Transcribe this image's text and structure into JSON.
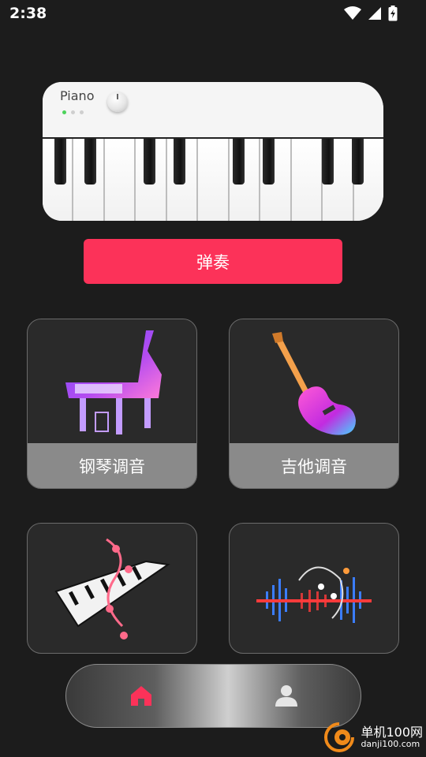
{
  "status_bar": {
    "time": "2:38"
  },
  "piano_widget": {
    "label": "Piano"
  },
  "play_button": {
    "label": "弹奏"
  },
  "tiles": {
    "piano_tuning": {
      "label": "钢琴调音"
    },
    "guitar_tuning": {
      "label": "吉他调音"
    }
  },
  "colors": {
    "accent": "#fc3259",
    "background": "#1c1c1c",
    "tile": "#2a2a2a",
    "tile_footer": "#8a8a8a"
  },
  "nav": {
    "icons": [
      "home-icon",
      "user-icon"
    ],
    "active": "home-icon"
  },
  "watermark": {
    "title": "单机100网",
    "url": "danji100.com"
  }
}
